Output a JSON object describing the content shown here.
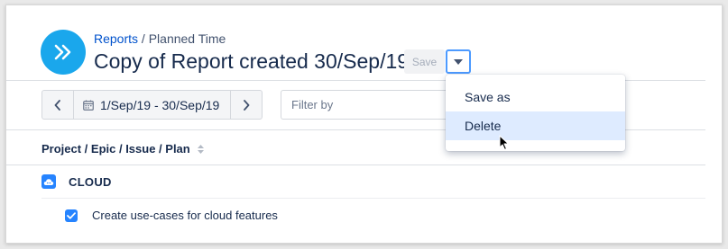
{
  "breadcrumb": {
    "parent": "Reports",
    "separator": " / ",
    "current": "Planned Time"
  },
  "title": "Copy of Report created 30/Sep/19",
  "header_actions": {
    "save_label": "Save",
    "dropdown_icon": "caret-down-icon"
  },
  "date_nav": {
    "range": "1/Sep/19 - 30/Sep/19",
    "prev_icon": "chevron-left-icon",
    "next_icon": "chevron-right-icon",
    "calendar_icon": "calendar-icon"
  },
  "filter": {
    "placeholder": "Filter by"
  },
  "table": {
    "column_header": "Project / Epic / Issue / Plan"
  },
  "rows": [
    {
      "label": "CLOUD",
      "icon": "cloud-project-icon"
    },
    {
      "label": "Create use-cases for cloud features",
      "checked": true
    }
  ],
  "dropdown_menu": {
    "items": [
      "Save as",
      "Delete"
    ],
    "highlighted": "Delete"
  },
  "colors": {
    "brand_logo": "#1aa7ec",
    "link": "#0052cc",
    "highlight": "#deebff",
    "focus_border": "#4c9aff",
    "checkbox": "#2684ff"
  }
}
